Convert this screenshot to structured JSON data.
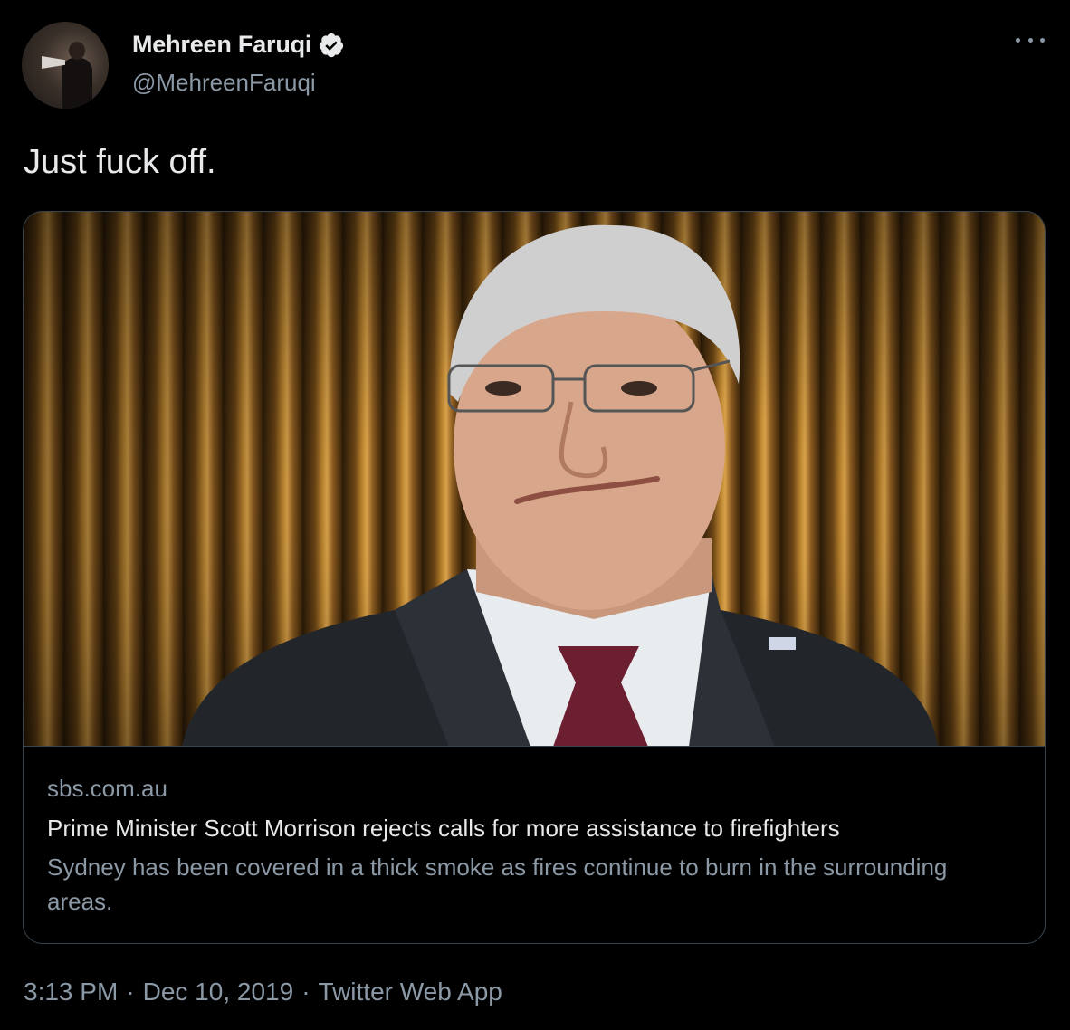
{
  "author": {
    "display_name": "Mehreen Faruqi",
    "handle": "@MehreenFaruqi",
    "verified_icon": "verified-badge-icon",
    "accent_color": "#e7e9ea"
  },
  "tweet": {
    "text": "Just fuck off."
  },
  "link_card": {
    "domain": "sbs.com.au",
    "title": "Prime Minister Scott Morrison rejects calls for more assistance to firefighters",
    "description": "Sydney has been covered in a thick smoke as fires continue to burn in the surrounding areas."
  },
  "meta": {
    "time": "3:13 PM",
    "separator": "·",
    "date": "Dec 10, 2019",
    "source": "Twitter Web App"
  },
  "colors": {
    "background": "#000000",
    "primary_text": "#e7e9ea",
    "secondary_text": "#8b98a5",
    "border": "#38444d"
  }
}
